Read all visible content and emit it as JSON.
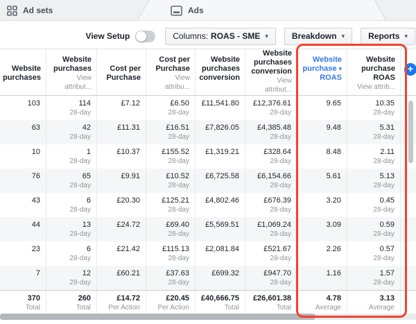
{
  "tabs": {
    "ad_sets": {
      "label": "Ad sets"
    },
    "ads": {
      "label": "Ads"
    }
  },
  "toolbar": {
    "view_setup_label": "View Setup",
    "columns_prefix": "Columns:",
    "columns_value": "ROAS - SME",
    "breakdown_label": "Breakdown",
    "reports_label": "Reports"
  },
  "icons": {
    "caret_down": "▾",
    "sort_desc": "▾",
    "plus": "+"
  },
  "table": {
    "columns": [
      {
        "title": "Website purchases",
        "sub": "",
        "attribution": false
      },
      {
        "title": "Website purchases",
        "sub": "View attribut...",
        "attribution": true
      },
      {
        "title": "Cost per Purchase",
        "sub": "",
        "attribution": false
      },
      {
        "title": "Cost per Purchase",
        "sub": "View attribu...",
        "attribution": true
      },
      {
        "title": "Website purchases conversion",
        "sub": "",
        "attribution": false
      },
      {
        "title": "Website purchases conversion",
        "sub": "View attribut...",
        "attribution": true
      },
      {
        "title": "Website purchase",
        "title2": "ROAS",
        "sub": "",
        "attribution": false,
        "sorted": true
      },
      {
        "title": "Website purchase ROAS",
        "sub": "View attrib...",
        "attribution": true
      }
    ],
    "attribution_window": "28-day",
    "rows": [
      [
        "103",
        "114",
        "£7.12",
        "£6.50",
        "£11,541.80",
        "£12,376.61",
        "9.65",
        "10.35"
      ],
      [
        "63",
        "42",
        "£11.31",
        "£16.51",
        "£7,826.05",
        "£4,385.48",
        "9.48",
        "5.31"
      ],
      [
        "10",
        "1",
        "£10.37",
        "£155.52",
        "£1,319.21",
        "£328.64",
        "8.48",
        "2.11"
      ],
      [
        "76",
        "65",
        "£9.91",
        "£10.52",
        "£6,725.58",
        "£6,154.66",
        "5.61",
        "5.13"
      ],
      [
        "43",
        "6",
        "£20.30",
        "£125.21",
        "£4,802.46",
        "£676.39",
        "3.20",
        "0.45"
      ],
      [
        "44",
        "13",
        "£24.72",
        "£69.40",
        "£5,569.51",
        "£1,069.24",
        "3.09",
        "0.59"
      ],
      [
        "23",
        "6",
        "£21.42",
        "£115.13",
        "£2,081.84",
        "£521.67",
        "2.26",
        "0.57"
      ],
      [
        "7",
        "12",
        "£60.21",
        "£37.63",
        "£699.32",
        "£947.70",
        "1.16",
        "1.57"
      ]
    ],
    "totals": {
      "values": [
        "370",
        "260",
        "£14.72",
        "£20.45",
        "£40,666.75",
        "£26,601.38",
        "4.78",
        "3.13"
      ],
      "labels": [
        "Total",
        "Total",
        "Per Action",
        "Per Action",
        "Total",
        "Total",
        "Average",
        "Average"
      ]
    }
  },
  "colors": {
    "sorted_header_blue": "#3578e5",
    "annotation_red": "#f5412b",
    "add_button_blue": "#1877f2"
  }
}
